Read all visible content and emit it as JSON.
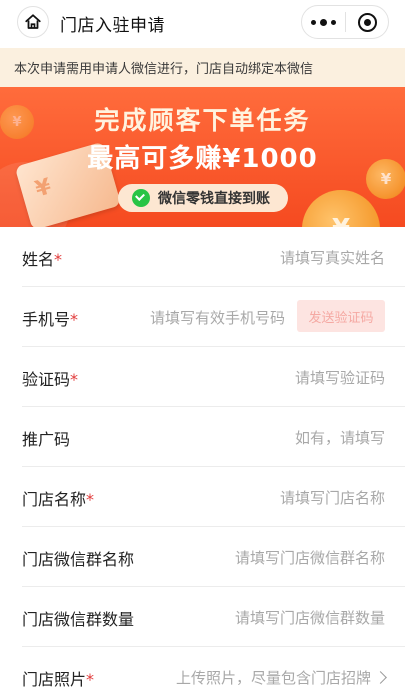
{
  "header": {
    "title": "门店入驻申请"
  },
  "notice": {
    "text": "本次申请需用申请人微信进行，门店自动绑定本微信"
  },
  "banner": {
    "line1": "完成顾客下单任务",
    "line2": "最高可多赚¥1000",
    "pill_text": "微信零钱直接到账",
    "coin_symbol": "¥"
  },
  "form": {
    "name": {
      "label": "姓名",
      "required": "*",
      "placeholder": "请填写真实姓名"
    },
    "phone": {
      "label": "手机号",
      "required": "*",
      "placeholder": "请填写有效手机号码",
      "button": "发送验证码"
    },
    "code": {
      "label": "验证码",
      "required": "*",
      "placeholder": "请填写验证码"
    },
    "promo": {
      "label": "推广码",
      "placeholder": "如有，请填写"
    },
    "store_name": {
      "label": "门店名称",
      "required": "*",
      "placeholder": "请填写门店名称"
    },
    "group_name": {
      "label": "门店微信群名称",
      "placeholder": "请填写门店微信群名称"
    },
    "group_count": {
      "label": "门店微信群数量",
      "placeholder": "请填写门店微信群数量"
    },
    "photo": {
      "label": "门店照片",
      "required": "*",
      "placeholder": "上传照片，尽量包含门店招牌"
    }
  },
  "colors": {
    "accent": "#f54a20",
    "required": "#e23b3b",
    "notice_bg": "#fbf0df",
    "sms_button_bg": "#fde4e1"
  }
}
